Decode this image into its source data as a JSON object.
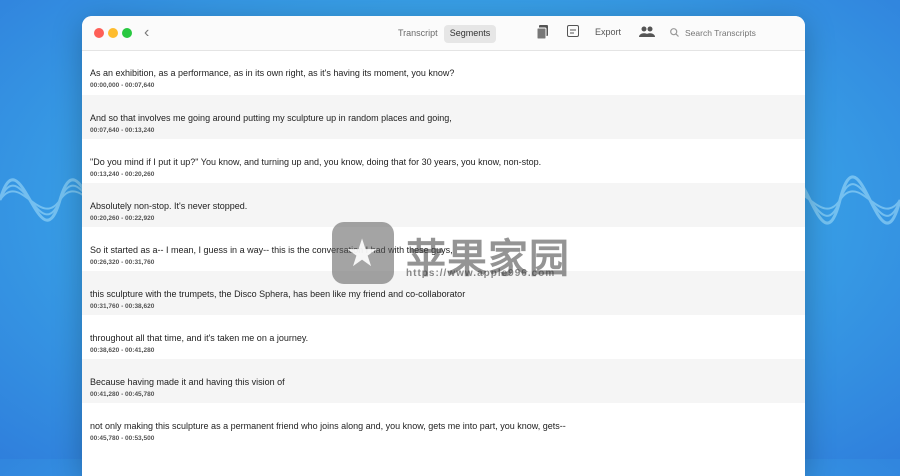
{
  "toolbar": {
    "back_icon": "chevron-left-icon",
    "tabs": [
      {
        "label": "Transcript",
        "active": false
      },
      {
        "label": "Segments",
        "active": true
      }
    ],
    "export_label": "Export",
    "search_placeholder": "Search Transcripts"
  },
  "segments": [
    {
      "text": "As an exhibition, as a performance, as in its own right, as it's having its moment, you know?",
      "time": "00:00,000 - 00:07,640"
    },
    {
      "text": "And so that involves me going around putting my sculpture up in random places and going,",
      "time": "00:07,640 - 00:13,240"
    },
    {
      "text": "\"Do you mind if I put it up?\" You know, and turning up and, you know, doing that for 30 years, you know, non-stop.",
      "time": "00:13,240 - 00:20,260"
    },
    {
      "text": "Absolutely non-stop. It's never stopped.",
      "time": "00:20,260 - 00:22,920"
    },
    {
      "text": "So it started as a-- I mean, I guess in a way-- this is the conversation I had with these guys,",
      "time": "00:26,320 - 00:31,760"
    },
    {
      "text": "this sculpture with the trumpets, the Disco Sphera, has been like my friend and co-collaborator",
      "time": "00:31,760 - 00:38,620"
    },
    {
      "text": "throughout all that time, and it's taken me on a journey.",
      "time": "00:38,620 - 00:41,280"
    },
    {
      "text": "Because having made it and having this vision of",
      "time": "00:41,280 - 00:45,780"
    },
    {
      "text": "not only making this sculpture as a permanent friend who joins along and, you know, gets me into part, you know, gets--",
      "time": "00:45,780 - 00:53,500"
    }
  ],
  "watermark": {
    "title": "苹果家园",
    "url": "https://www.apple996.com"
  },
  "colors": {
    "background": "#3aa6e8",
    "traffic_red": "#fe5f57",
    "traffic_yellow": "#febc2e",
    "traffic_green": "#28c840"
  }
}
